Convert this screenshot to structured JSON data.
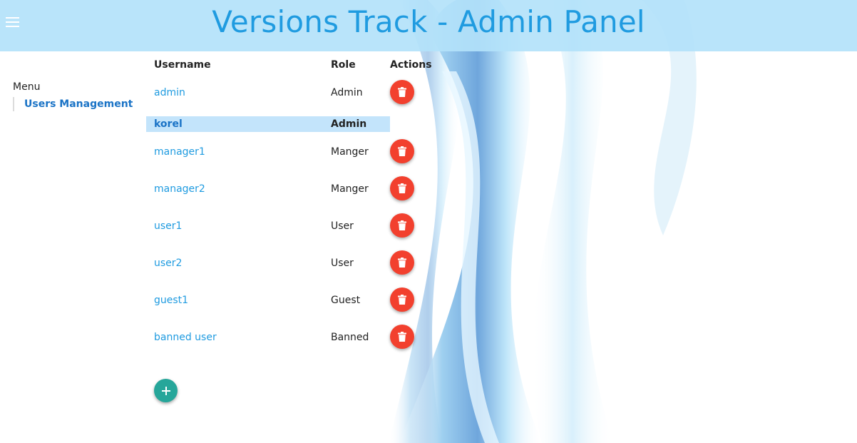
{
  "header": {
    "title": "Versions Track - Admin Panel",
    "menu_icon": "hamburger-menu-icon"
  },
  "sidebar": {
    "heading": "Menu",
    "items": [
      {
        "label": "Users Management"
      }
    ]
  },
  "table": {
    "columns": [
      "Username",
      "Role",
      "Actions"
    ],
    "rows": [
      {
        "username": "admin",
        "role": "Admin",
        "selected": false
      },
      {
        "username": "korel",
        "role": "Admin",
        "selected": true
      },
      {
        "username": "manager1",
        "role": "Manger",
        "selected": false
      },
      {
        "username": "manager2",
        "role": "Manger",
        "selected": false
      },
      {
        "username": "user1",
        "role": "User",
        "selected": false
      },
      {
        "username": "user2",
        "role": "User",
        "selected": false
      },
      {
        "username": "guest1",
        "role": "Guest",
        "selected": false
      },
      {
        "username": "banned user",
        "role": "Banned",
        "selected": false
      }
    ]
  },
  "icons": {
    "delete": "trash-icon",
    "add": "plus-icon"
  },
  "colors": {
    "header_bg": "#b3e2fa",
    "title": "#1f9be0",
    "delete": "#f2402e",
    "add": "#26a69a",
    "selected_row": "#c3e4fb"
  }
}
